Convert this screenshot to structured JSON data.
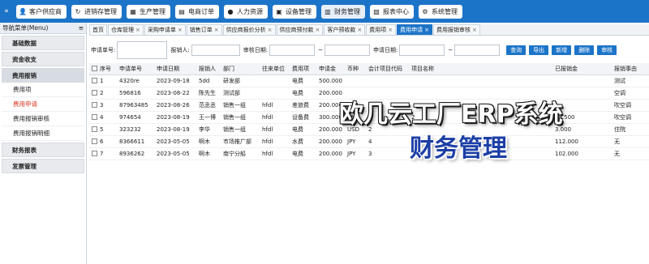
{
  "topnav": {
    "collapse_icon": "«",
    "items": [
      {
        "label": "客户供应商",
        "icon": "user-icon"
      },
      {
        "label": "进销存管理",
        "icon": "refresh-icon"
      },
      {
        "label": "生产管理",
        "icon": "factory-icon"
      },
      {
        "label": "电商订单",
        "icon": "cart-icon"
      },
      {
        "label": "人力资源",
        "icon": "people-icon"
      },
      {
        "label": "设备管理",
        "icon": "device-icon"
      },
      {
        "label": "财务管理",
        "icon": "wallet-icon"
      },
      {
        "label": "报表中心",
        "icon": "report-icon"
      },
      {
        "label": "系统管理",
        "icon": "gear-icon"
      }
    ]
  },
  "sidebar": {
    "title": "导航菜单(Menu)",
    "title_icon": "≡",
    "items": [
      {
        "label": "基础数据"
      },
      {
        "label": "资金收支"
      },
      {
        "label": "费用报销"
      }
    ],
    "subitems": [
      {
        "label": "费用项"
      },
      {
        "label": "费用申请"
      },
      {
        "label": "费用报销审核"
      },
      {
        "label": "费用报销明细"
      }
    ],
    "items_after": [
      {
        "label": "财务报表"
      },
      {
        "label": "发票管理"
      }
    ]
  },
  "tabs": [
    {
      "label": "首页",
      "closable": false
    },
    {
      "label": "仓库管理",
      "closable": true
    },
    {
      "label": "采购申请单",
      "closable": true
    },
    {
      "label": "销售订单",
      "closable": true
    },
    {
      "label": "供应商报价分析",
      "closable": true
    },
    {
      "label": "供应商预付款",
      "closable": true
    },
    {
      "label": "客户预收款",
      "closable": true
    },
    {
      "label": "费用项",
      "closable": true
    },
    {
      "label": "费用申请",
      "closable": true,
      "active": true
    },
    {
      "label": "费用报销审核",
      "closable": true
    }
  ],
  "filter": {
    "apply_no_label": "申请单号:",
    "applicant_label": "报销人:",
    "review_date_label": "审核日期:",
    "apply_date_label": "申请日期:",
    "range_sep": "~",
    "buttons": {
      "search": "查询",
      "export": "导出",
      "add": "新增",
      "delete": "删除",
      "review": "审核"
    }
  },
  "table": {
    "headers": [
      "序号",
      "申请单号",
      "申请日期",
      "报销人",
      "部门",
      "往来单位",
      "费用项",
      "申请金",
      "币种",
      "会计项目代码",
      "项目名称",
      "已报销金",
      "报销事由"
    ],
    "rows": [
      {
        "no": "1",
        "code": "4320re",
        "date": "2023-09-18",
        "person": "5dd",
        "dept": "研发部",
        "partner": "",
        "item": "电费",
        "amount": "500.000",
        "currency": "",
        "acct": "",
        "project": "",
        "reimbursed": "",
        "reason": "测试"
      },
      {
        "no": "2",
        "code": "596816",
        "date": "2023-08-22",
        "person": "陈先生",
        "dept": "测试部",
        "partner": "",
        "item": "电费",
        "amount": "200.000",
        "currency": "",
        "acct": "",
        "project": "",
        "reimbursed": "",
        "reason": "空调"
      },
      {
        "no": "3",
        "code": "87963485",
        "date": "2023-08-26",
        "person": "范丞丞",
        "dept": "销售一组",
        "partner": "hfdl",
        "item": "差旅费",
        "amount": "200.000",
        "currency": "",
        "acct": "",
        "project": "",
        "reimbursed": "",
        "reason": "吹空调"
      },
      {
        "no": "4",
        "code": "974654",
        "date": "2023-08-19",
        "person": "王一博",
        "dept": "销售一组",
        "partner": "hfdl",
        "item": "设备费",
        "amount": "300.000",
        "currency": "RMB",
        "acct": "2",
        "project": "2",
        "reimbursed": "33.500",
        "reason": "吹空调"
      },
      {
        "no": "5",
        "code": "323232",
        "date": "2023-08-19",
        "person": "李华",
        "dept": "销售一组",
        "partner": "hfdl",
        "item": "电费",
        "amount": "200.000",
        "currency": "USD",
        "acct": "2",
        "project": "",
        "reimbursed": "3.000",
        "reason": "住院"
      },
      {
        "no": "6",
        "code": "8366611",
        "date": "2023-05-05",
        "person": "啊木",
        "dept": "市场推广部",
        "partner": "hfdl",
        "item": "水费",
        "amount": "200.000",
        "currency": "JPY",
        "acct": "4",
        "project": "",
        "reimbursed": "112.000",
        "reason": "无"
      },
      {
        "no": "7",
        "code": "8936262",
        "date": "2023-05-05",
        "person": "啊木",
        "dept": "南宁分船",
        "partner": "hfdl",
        "item": "电费",
        "amount": "200.000",
        "currency": "JPY",
        "acct": "3",
        "project": "3",
        "reimbursed": "102.000",
        "reason": "无"
      }
    ]
  },
  "overlay": {
    "title": "欧几云工厂ERP系统",
    "subtitle": "财务管理"
  },
  "colors": {
    "brand": "#1c74c8",
    "active_sub": "#d9321f",
    "overlay_sub": "#1c3fa6"
  }
}
